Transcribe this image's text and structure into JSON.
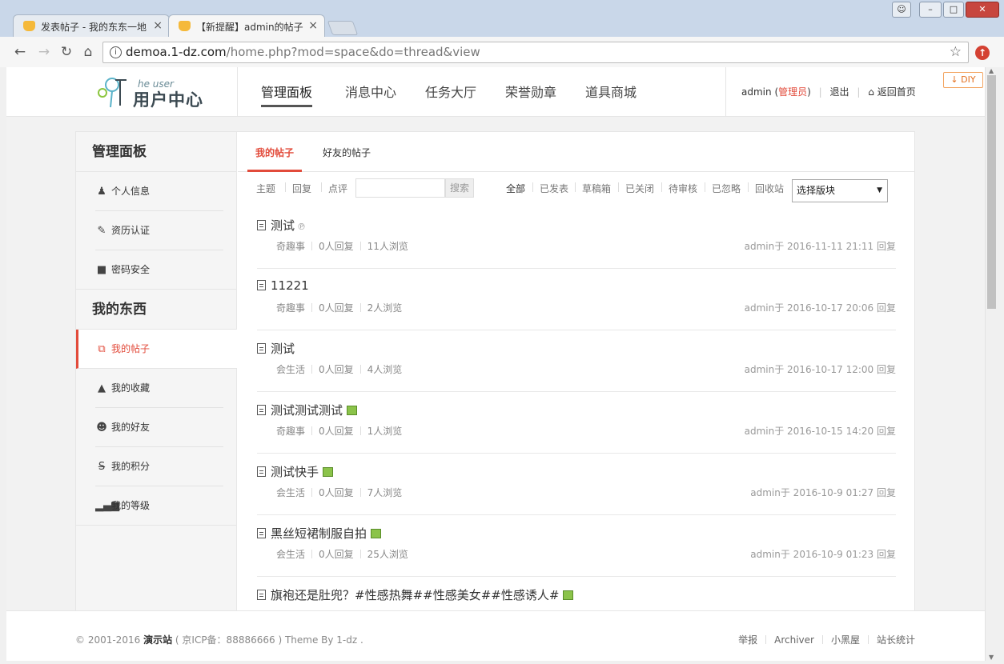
{
  "browser": {
    "tabs": [
      {
        "title": "发表帖子 - 我的东东一地",
        "close": "×"
      },
      {
        "title": "【新提醒】admin的帖子",
        "close": "×"
      }
    ],
    "url_host": "demoa.1-dz.com",
    "url_path": "/home.php?mod=space&do=thread&view",
    "window_buttons": {
      "minimize": "–",
      "restore": "□",
      "close": "✕"
    }
  },
  "header": {
    "logo_small": "he user",
    "logo_big": "用户中心",
    "nav": [
      "管理面板",
      "消息中心",
      "任务大厅",
      "荣誉勋章",
      "道具商城"
    ],
    "user": {
      "name": "admin",
      "role": "管理员",
      "logout": "退出",
      "home": "返回首页"
    },
    "diy": "DIY"
  },
  "sidebar": {
    "section1": "管理面板",
    "items1": [
      {
        "label": "个人信息",
        "icon": "user-icon"
      },
      {
        "label": "资历认证",
        "icon": "edit-icon"
      },
      {
        "label": "密码安全",
        "icon": "lock-icon"
      }
    ],
    "section2": "我的东西",
    "items2": [
      {
        "label": "我的帖子",
        "icon": "copy-icon",
        "active": true
      },
      {
        "label": "我的收藏",
        "icon": "folder-open-icon"
      },
      {
        "label": "我的好友",
        "icon": "users-icon"
      },
      {
        "label": "我的积分",
        "icon": "strike-icon"
      },
      {
        "label": "我的等级",
        "icon": "signal-icon"
      }
    ]
  },
  "main": {
    "tabs": [
      "我的帖子",
      "好友的帖子"
    ],
    "filter": {
      "types": [
        "主题",
        "回复",
        "点评"
      ],
      "search_button": "搜索",
      "status": [
        "全部",
        "已发表",
        "草稿箱",
        "已关闭",
        "待审核",
        "已忽略",
        "回收站"
      ],
      "select": "选择版块"
    },
    "threads": [
      {
        "title": "测试",
        "forum": "奇趣事",
        "replies": "0人回复",
        "views": "11人浏览",
        "info": "admin于 2016-11-11 21:11 回复",
        "attach": "clip"
      },
      {
        "title": "11221",
        "forum": "奇趣事",
        "replies": "0人回复",
        "views": "2人浏览",
        "info": "admin于 2016-10-17 20:06 回复",
        "attach": ""
      },
      {
        "title": "测试",
        "forum": "会生活",
        "replies": "0人回复",
        "views": "4人浏览",
        "info": "admin于 2016-10-17 12:00 回复",
        "attach": ""
      },
      {
        "title": "测试测试测试",
        "forum": "奇趣事",
        "replies": "0人回复",
        "views": "1人浏览",
        "info": "admin于 2016-10-15 14:20 回复",
        "attach": "image"
      },
      {
        "title": "测试快手",
        "forum": "会生活",
        "replies": "0人回复",
        "views": "7人浏览",
        "info": "admin于 2016-10-9 01:27 回复",
        "attach": "image"
      },
      {
        "title": "黑丝短裙制服自拍",
        "forum": "会生活",
        "replies": "0人回复",
        "views": "25人浏览",
        "info": "admin于 2016-10-9 01:23 回复",
        "attach": "image"
      },
      {
        "title": "旗袍还是肚兜？#性感热舞##性感美女##性感诱人#",
        "forum": "",
        "replies": "",
        "views": "",
        "info": "",
        "attach": "image"
      }
    ]
  },
  "footer": {
    "copyright": "© 2001-2016",
    "site": "演示站",
    "icp": "( 京ICP备：88886666 ) Theme By 1-dz .",
    "links": [
      "举报",
      "Archiver",
      "小黑屋",
      "站长统计"
    ]
  },
  "colors": {
    "accent": "#e24b3b"
  }
}
